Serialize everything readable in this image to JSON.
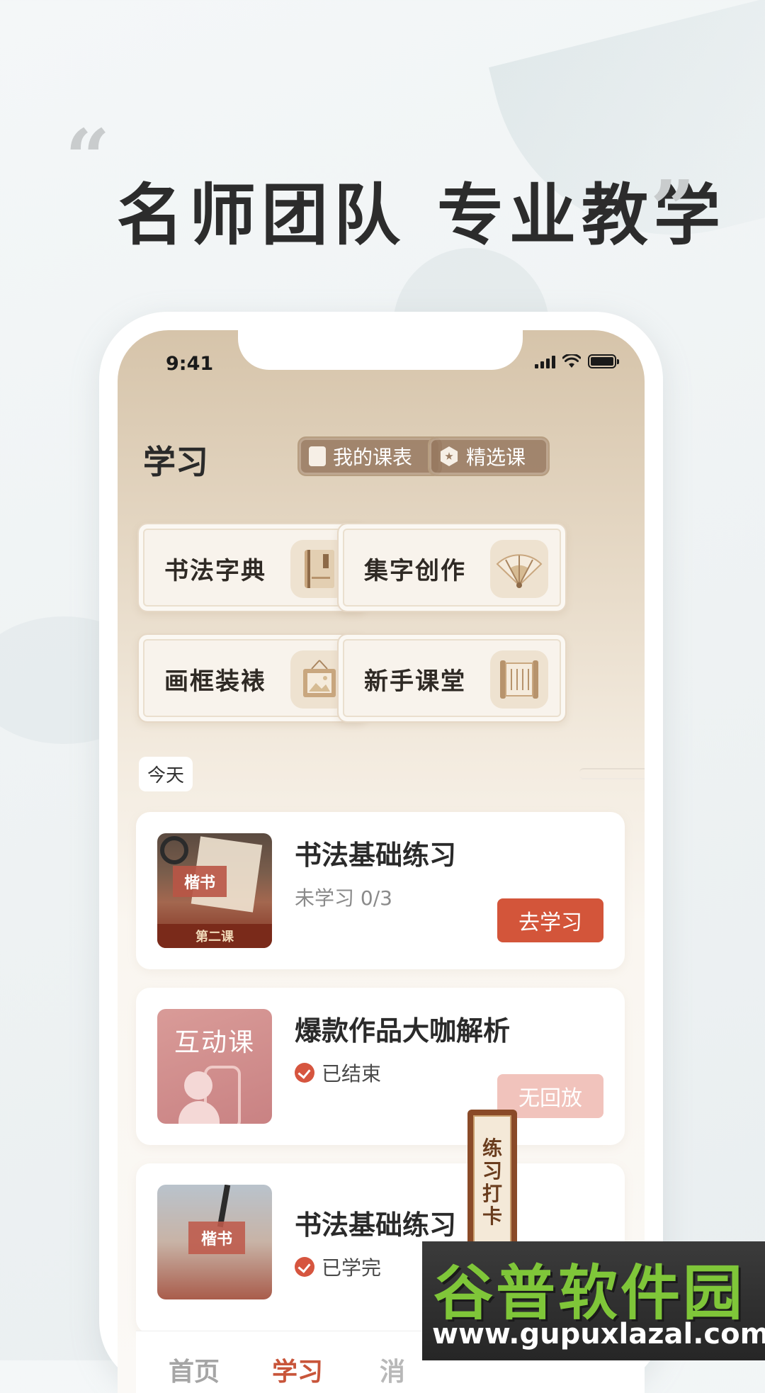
{
  "promo": {
    "quote_open": "“",
    "quote_close": "”",
    "headline_left": "名师团队",
    "headline_right": "专业教学"
  },
  "status_bar": {
    "time": "9:41",
    "icons": [
      "signal-icon",
      "wifi-icon",
      "battery-icon"
    ]
  },
  "header": {
    "title": "学习",
    "schedule_button": "我的课表",
    "featured_button": "精选课"
  },
  "shortcuts": [
    {
      "label": "书法字典",
      "icon": "book-icon"
    },
    {
      "label": "集字创作",
      "icon": "fan-icon",
      "icon_text": "集字创作"
    },
    {
      "label": "画框装裱",
      "icon": "picture-frame-icon"
    },
    {
      "label": "新手课堂",
      "icon": "scroll-icon"
    }
  ],
  "section": {
    "today": "今天"
  },
  "courses": [
    {
      "title": "书法基础练习",
      "status": "未学习 0/3",
      "action": "去学习",
      "thumb_tag": "楷书",
      "thumb_band": "第二课"
    },
    {
      "title": "爆款作品大咖解析",
      "status": "已结束",
      "action": "无回放",
      "thumb_tag": "互动课"
    },
    {
      "title": "书法基础练习",
      "status": "已学完",
      "thumb_tag": "楷书"
    }
  ],
  "float_tag": {
    "lines": [
      "练",
      "习",
      "打",
      "卡"
    ]
  },
  "tabbar": {
    "home": "首页",
    "study": "学习",
    "partial": "消"
  },
  "watermark": {
    "title": "谷普软件园",
    "url": "www.gupuxlazal.com"
  },
  "colors": {
    "accent": "#d3553a",
    "accent_disabled": "#f1c3bc",
    "tab_active": "#c8553a",
    "card_border": "#e6d8c6",
    "watermark_green": "#7fc639"
  }
}
